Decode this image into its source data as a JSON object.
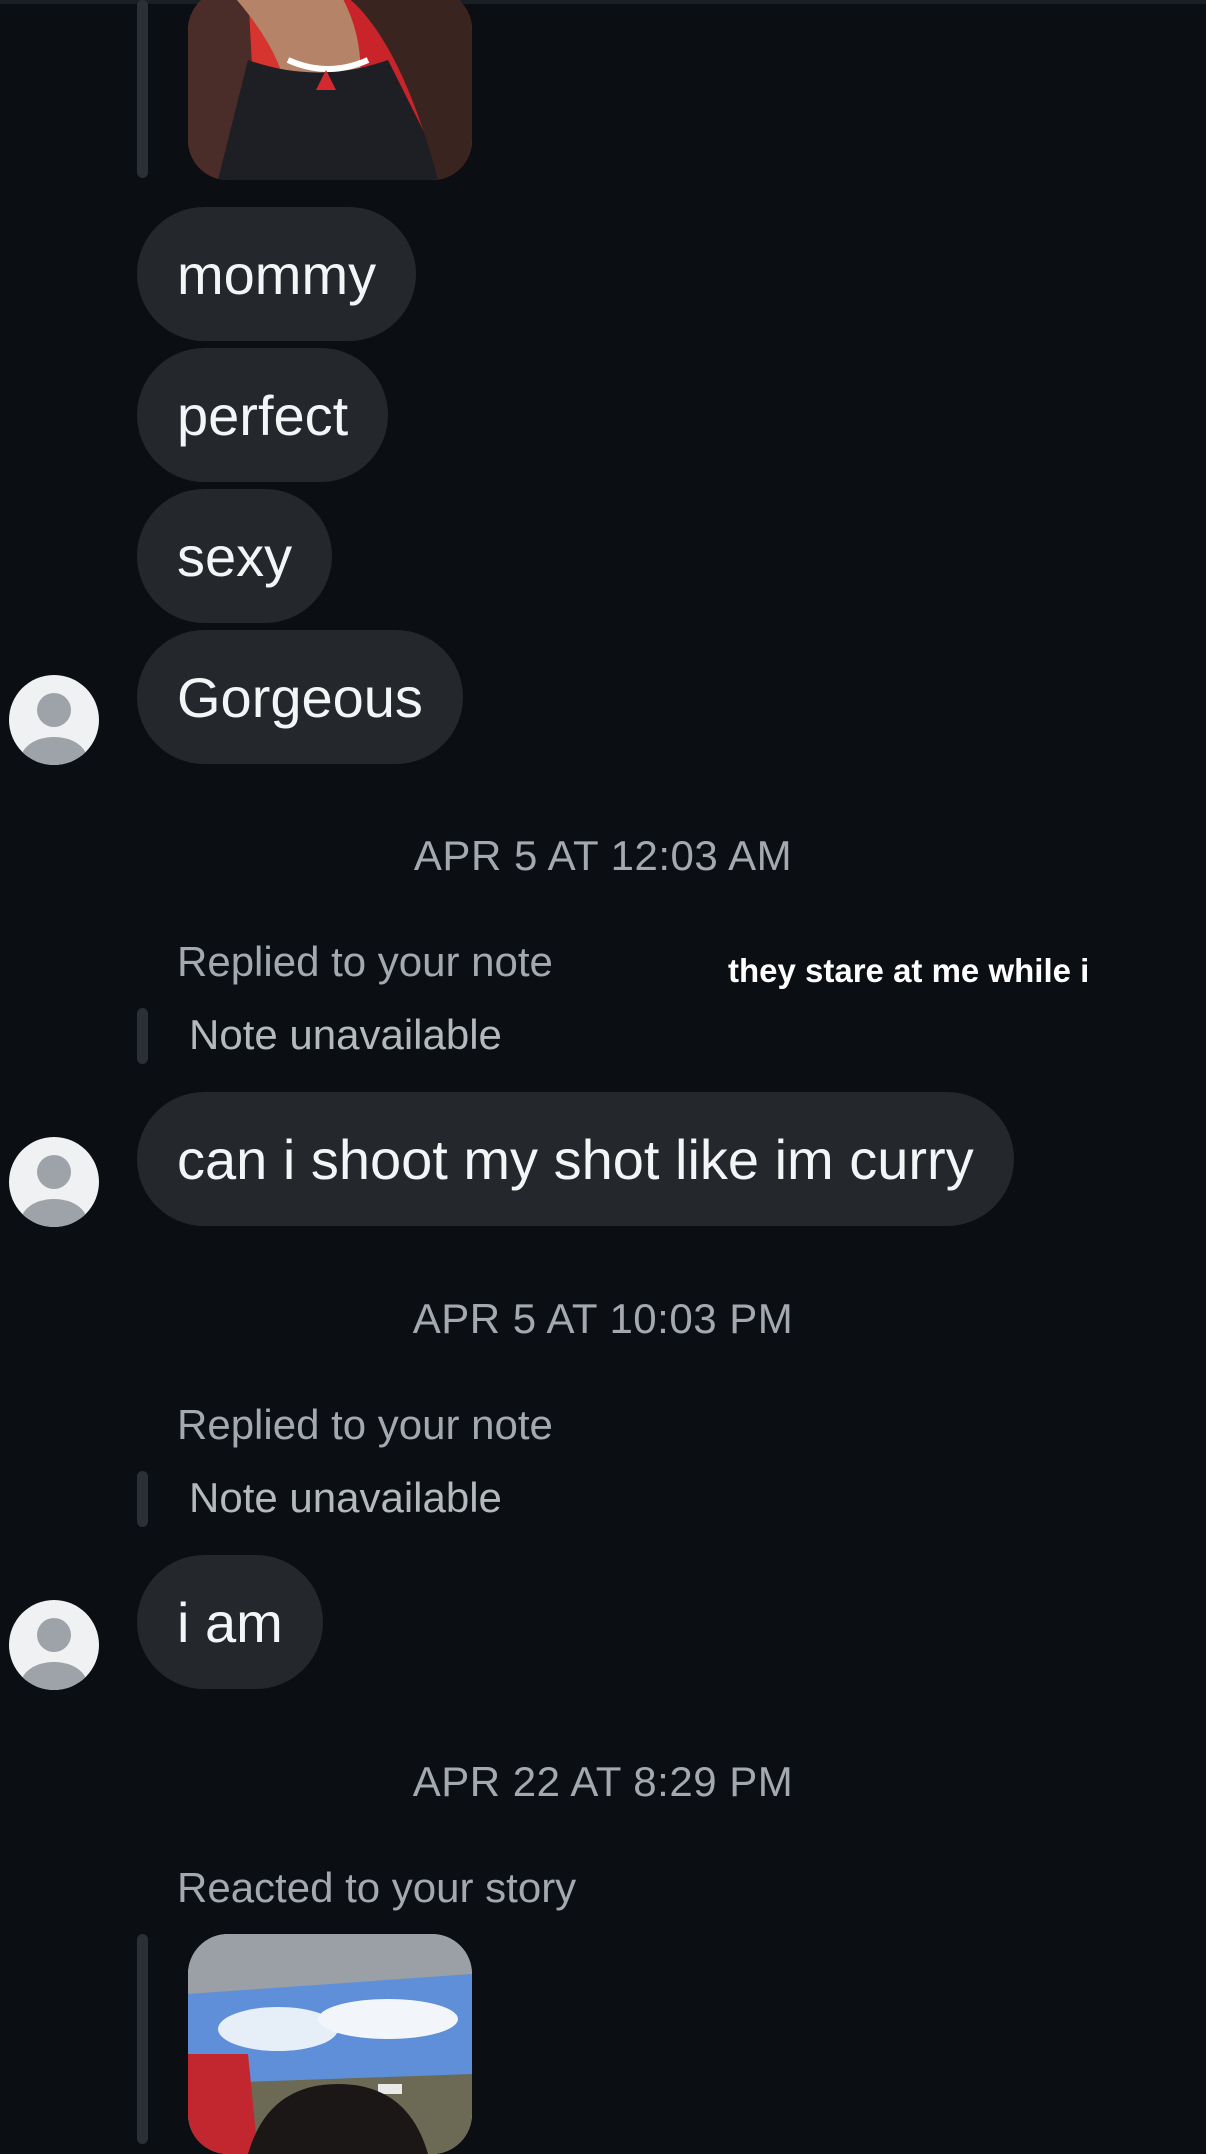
{
  "messages": {
    "m1": "mommy",
    "m2": "perfect",
    "m3": "sexy",
    "m4": "Gorgeous",
    "m5": "can i shoot my shot like im curry",
    "m6": "i am"
  },
  "timestamps": {
    "t1": "APR 5 AT 12:03 AM",
    "t2": "APR 5 AT 10:03 PM",
    "t3": "APR 22 AT 8:29 PM"
  },
  "replies": {
    "r1_label": "Replied to your note",
    "r1_note": "Note unavailable",
    "r1_preview": "they stare at me while i",
    "r2_label": "Replied to your note",
    "r2_note": "Note unavailable"
  },
  "reaction": {
    "label": "Reacted to your story"
  },
  "colors": {
    "background": "#0b0e12",
    "bubble": "#24272b",
    "meta_text": "#a4a9af"
  }
}
